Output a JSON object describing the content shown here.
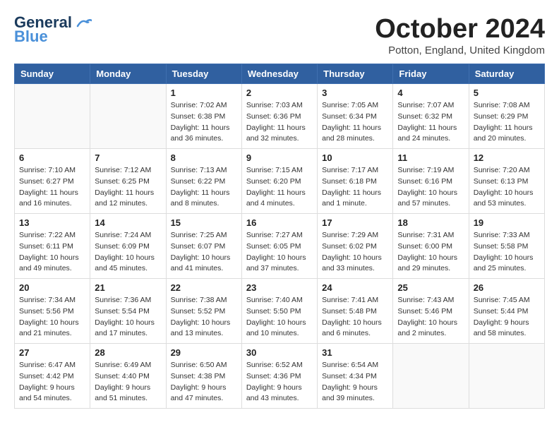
{
  "logo": {
    "line1": "General",
    "line2": "Blue"
  },
  "header": {
    "month": "October 2024",
    "location": "Potton, England, United Kingdom"
  },
  "weekdays": [
    "Sunday",
    "Monday",
    "Tuesday",
    "Wednesday",
    "Thursday",
    "Friday",
    "Saturday"
  ],
  "weeks": [
    [
      {
        "day": "",
        "info": ""
      },
      {
        "day": "",
        "info": ""
      },
      {
        "day": "1",
        "info": "Sunrise: 7:02 AM\nSunset: 6:38 PM\nDaylight: 11 hours and 36 minutes."
      },
      {
        "day": "2",
        "info": "Sunrise: 7:03 AM\nSunset: 6:36 PM\nDaylight: 11 hours and 32 minutes."
      },
      {
        "day": "3",
        "info": "Sunrise: 7:05 AM\nSunset: 6:34 PM\nDaylight: 11 hours and 28 minutes."
      },
      {
        "day": "4",
        "info": "Sunrise: 7:07 AM\nSunset: 6:32 PM\nDaylight: 11 hours and 24 minutes."
      },
      {
        "day": "5",
        "info": "Sunrise: 7:08 AM\nSunset: 6:29 PM\nDaylight: 11 hours and 20 minutes."
      }
    ],
    [
      {
        "day": "6",
        "info": "Sunrise: 7:10 AM\nSunset: 6:27 PM\nDaylight: 11 hours and 16 minutes."
      },
      {
        "day": "7",
        "info": "Sunrise: 7:12 AM\nSunset: 6:25 PM\nDaylight: 11 hours and 12 minutes."
      },
      {
        "day": "8",
        "info": "Sunrise: 7:13 AM\nSunset: 6:22 PM\nDaylight: 11 hours and 8 minutes."
      },
      {
        "day": "9",
        "info": "Sunrise: 7:15 AM\nSunset: 6:20 PM\nDaylight: 11 hours and 4 minutes."
      },
      {
        "day": "10",
        "info": "Sunrise: 7:17 AM\nSunset: 6:18 PM\nDaylight: 11 hours and 1 minute."
      },
      {
        "day": "11",
        "info": "Sunrise: 7:19 AM\nSunset: 6:16 PM\nDaylight: 10 hours and 57 minutes."
      },
      {
        "day": "12",
        "info": "Sunrise: 7:20 AM\nSunset: 6:13 PM\nDaylight: 10 hours and 53 minutes."
      }
    ],
    [
      {
        "day": "13",
        "info": "Sunrise: 7:22 AM\nSunset: 6:11 PM\nDaylight: 10 hours and 49 minutes."
      },
      {
        "day": "14",
        "info": "Sunrise: 7:24 AM\nSunset: 6:09 PM\nDaylight: 10 hours and 45 minutes."
      },
      {
        "day": "15",
        "info": "Sunrise: 7:25 AM\nSunset: 6:07 PM\nDaylight: 10 hours and 41 minutes."
      },
      {
        "day": "16",
        "info": "Sunrise: 7:27 AM\nSunset: 6:05 PM\nDaylight: 10 hours and 37 minutes."
      },
      {
        "day": "17",
        "info": "Sunrise: 7:29 AM\nSunset: 6:02 PM\nDaylight: 10 hours and 33 minutes."
      },
      {
        "day": "18",
        "info": "Sunrise: 7:31 AM\nSunset: 6:00 PM\nDaylight: 10 hours and 29 minutes."
      },
      {
        "day": "19",
        "info": "Sunrise: 7:33 AM\nSunset: 5:58 PM\nDaylight: 10 hours and 25 minutes."
      }
    ],
    [
      {
        "day": "20",
        "info": "Sunrise: 7:34 AM\nSunset: 5:56 PM\nDaylight: 10 hours and 21 minutes."
      },
      {
        "day": "21",
        "info": "Sunrise: 7:36 AM\nSunset: 5:54 PM\nDaylight: 10 hours and 17 minutes."
      },
      {
        "day": "22",
        "info": "Sunrise: 7:38 AM\nSunset: 5:52 PM\nDaylight: 10 hours and 13 minutes."
      },
      {
        "day": "23",
        "info": "Sunrise: 7:40 AM\nSunset: 5:50 PM\nDaylight: 10 hours and 10 minutes."
      },
      {
        "day": "24",
        "info": "Sunrise: 7:41 AM\nSunset: 5:48 PM\nDaylight: 10 hours and 6 minutes."
      },
      {
        "day": "25",
        "info": "Sunrise: 7:43 AM\nSunset: 5:46 PM\nDaylight: 10 hours and 2 minutes."
      },
      {
        "day": "26",
        "info": "Sunrise: 7:45 AM\nSunset: 5:44 PM\nDaylight: 9 hours and 58 minutes."
      }
    ],
    [
      {
        "day": "27",
        "info": "Sunrise: 6:47 AM\nSunset: 4:42 PM\nDaylight: 9 hours and 54 minutes."
      },
      {
        "day": "28",
        "info": "Sunrise: 6:49 AM\nSunset: 4:40 PM\nDaylight: 9 hours and 51 minutes."
      },
      {
        "day": "29",
        "info": "Sunrise: 6:50 AM\nSunset: 4:38 PM\nDaylight: 9 hours and 47 minutes."
      },
      {
        "day": "30",
        "info": "Sunrise: 6:52 AM\nSunset: 4:36 PM\nDaylight: 9 hours and 43 minutes."
      },
      {
        "day": "31",
        "info": "Sunrise: 6:54 AM\nSunset: 4:34 PM\nDaylight: 9 hours and 39 minutes."
      },
      {
        "day": "",
        "info": ""
      },
      {
        "day": "",
        "info": ""
      }
    ]
  ]
}
